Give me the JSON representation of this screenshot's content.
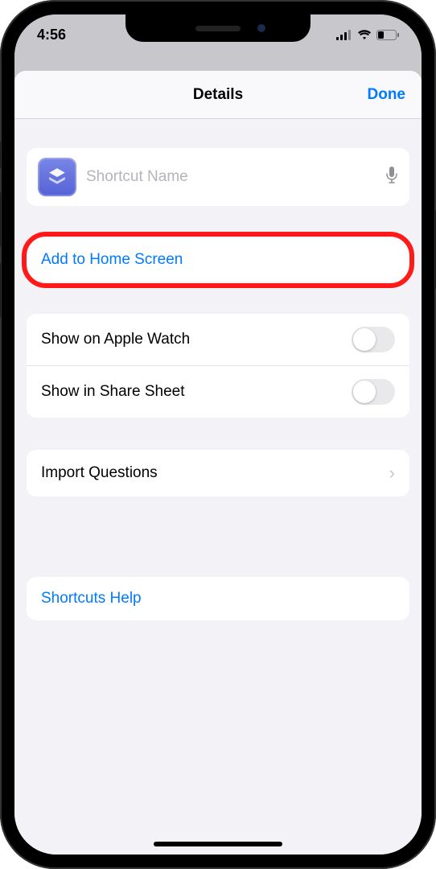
{
  "status": {
    "time": "4:56"
  },
  "sheet": {
    "title": "Details",
    "done": "Done"
  },
  "name_field": {
    "placeholder": "Shortcut Name",
    "value": ""
  },
  "rows": {
    "add_home": "Add to Home Screen",
    "apple_watch": "Show on Apple Watch",
    "share_sheet": "Show in Share Sheet",
    "import_questions": "Import Questions",
    "shortcuts_help": "Shortcuts Help"
  },
  "toggles": {
    "apple_watch_on": false,
    "share_sheet_on": false
  }
}
